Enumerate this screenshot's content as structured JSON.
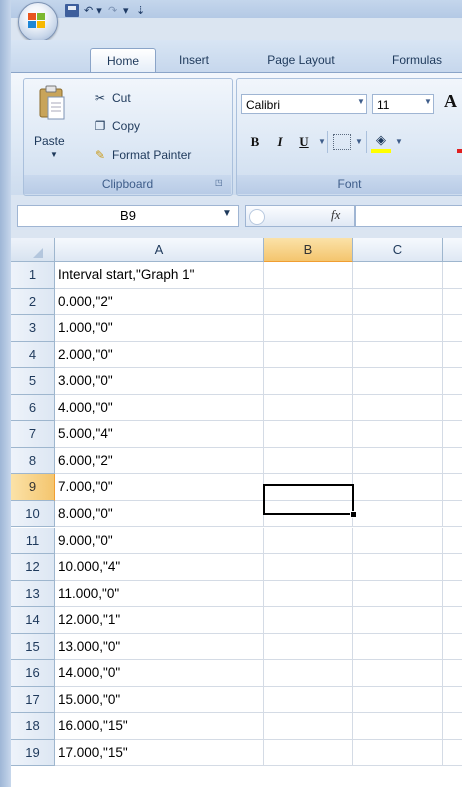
{
  "ribbon": {
    "tabs": [
      {
        "label": "Home"
      },
      {
        "label": "Insert"
      },
      {
        "label": "Page Layout"
      },
      {
        "label": "Formulas"
      }
    ],
    "clipboard": {
      "group_label": "Clipboard",
      "paste": "Paste",
      "cut": "Cut",
      "copy": "Copy",
      "format_painter": "Format Painter"
    },
    "font": {
      "group_label": "Font",
      "name": "Calibri",
      "size": "11",
      "grow": "A",
      "bold": "B",
      "italic": "I",
      "underline": "U"
    }
  },
  "formula_bar": {
    "name_box": "B9",
    "fx": "fx",
    "value": ""
  },
  "sheet": {
    "columns": [
      "A",
      "B",
      "C"
    ],
    "selected_cell": "B9",
    "rows": [
      {
        "n": "1",
        "a": "Interval start,\"Graph 1\""
      },
      {
        "n": "2",
        "a": "0.000,\"2\""
      },
      {
        "n": "3",
        "a": "1.000,\"0\""
      },
      {
        "n": "4",
        "a": "2.000,\"0\""
      },
      {
        "n": "5",
        "a": "3.000,\"0\""
      },
      {
        "n": "6",
        "a": "4.000,\"0\""
      },
      {
        "n": "7",
        "a": "5.000,\"4\""
      },
      {
        "n": "8",
        "a": "6.000,\"2\""
      },
      {
        "n": "9",
        "a": "7.000,\"0\""
      },
      {
        "n": "10",
        "a": "8.000,\"0\""
      },
      {
        "n": "11",
        "a": "9.000,\"0\""
      },
      {
        "n": "12",
        "a": "10.000,\"4\""
      },
      {
        "n": "13",
        "a": "11.000,\"0\""
      },
      {
        "n": "14",
        "a": "12.000,\"1\""
      },
      {
        "n": "15",
        "a": "13.000,\"0\""
      },
      {
        "n": "16",
        "a": "14.000,\"0\""
      },
      {
        "n": "17",
        "a": "15.000,\"0\""
      },
      {
        "n": "18",
        "a": "16.000,\"15\""
      },
      {
        "n": "19",
        "a": "17.000,\"15\""
      }
    ]
  }
}
